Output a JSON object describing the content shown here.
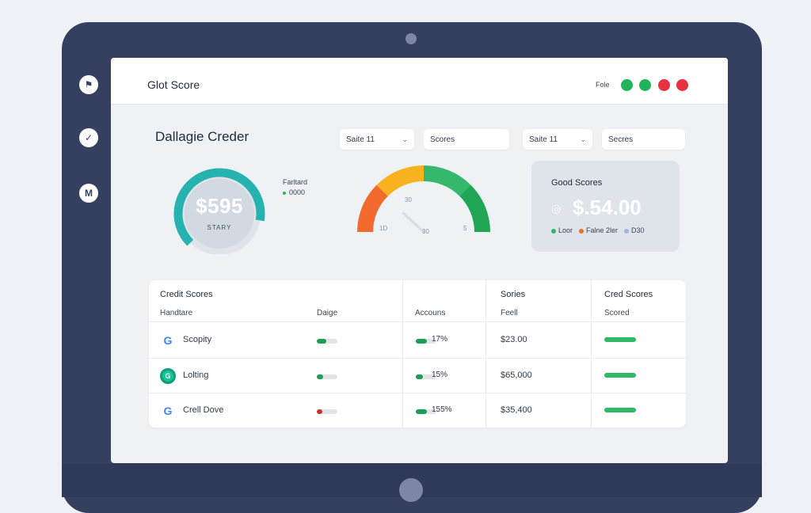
{
  "app": {
    "title": "Glot Score",
    "header_label": "Fole"
  },
  "window_dots": [
    {
      "name": "green-dot-1",
      "color": "#21b35a"
    },
    {
      "name": "green-dot-2",
      "color": "#21b35a"
    },
    {
      "name": "red-dot-1",
      "color": "#e8323f"
    },
    {
      "name": "red-dot-2",
      "color": "#e8323f"
    }
  ],
  "sidebar_icons": [
    "flag-icon",
    "check-icon",
    "mail-icon"
  ],
  "sidebar_glyphs": [
    "⚑",
    "✓",
    "M"
  ],
  "page": {
    "heading": "Dallagie Creder"
  },
  "filters": [
    {
      "label": "Saite 11",
      "chevron": "⌄"
    },
    {
      "label": "Scores"
    },
    {
      "label": "Saite 11",
      "chevron": "⌄"
    },
    {
      "label": "Secres"
    }
  ],
  "score_ring": {
    "value": "$595",
    "sublabel": "STARY",
    "accent": "#26b3b0",
    "progress": 0.72
  },
  "ring_legend": {
    "title": "Farltard",
    "value": "0000"
  },
  "gauge": {
    "colors": [
      "#f26a2e",
      "#f8b21e",
      "#35b86b",
      "#20a554"
    ],
    "labels": [
      "1D",
      "30",
      "30",
      "5"
    ]
  },
  "good_scores": {
    "title": "Good Scores",
    "icon": "◎",
    "value": "$.54.00",
    "legend": [
      {
        "label": "Loor",
        "color": "#2fb865"
      },
      {
        "label": "Falne 2ler",
        "color": "#f06a2d"
      },
      {
        "label": "D30",
        "color": "#a7b4e0"
      }
    ]
  },
  "table": {
    "title": "Credit Scores",
    "columns": [
      "Handtare",
      "Daige",
      "Accouns",
      "Feell",
      "Scored"
    ],
    "group_headers": [
      "Sories",
      "Cred Scores"
    ],
    "rows": [
      {
        "icon": "google-icon",
        "glyph": "G",
        "name": "Scopity",
        "bar_color": "#1f9d55",
        "bar_fill": 0.45,
        "pct": "17%",
        "pct_fill": 0.55,
        "amount": "$23.00"
      },
      {
        "icon": "grammarly-icon",
        "glyph": "G",
        "name": "Lolting",
        "bar_color": "#1f9d55",
        "bar_fill": 0.3,
        "pct": "15%",
        "pct_fill": 0.35,
        "amount": "$65,000"
      },
      {
        "icon": "google-icon",
        "glyph": "G",
        "name": "Crell Dove",
        "bar_color": "#c0392b",
        "bar_fill": 0.25,
        "pct": "155%",
        "pct_fill": 0.55,
        "amount": "$35,400"
      }
    ]
  }
}
